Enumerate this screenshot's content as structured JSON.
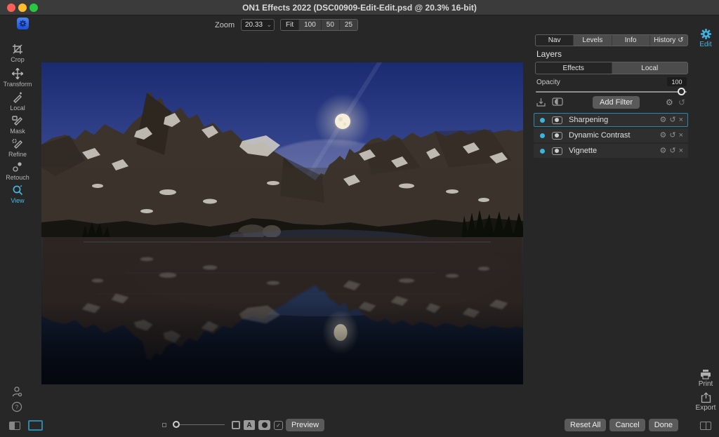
{
  "titlebar": {
    "title": "ON1 Effects 2022 (DSC00909-Edit-Edit.psd @ 20.3% 16-bit)"
  },
  "topbar": {
    "zoom_label": "Zoom",
    "zoom_value": "20.33",
    "fit_options": {
      "0": "Fit",
      "1": "100",
      "2": "50",
      "3": "25"
    },
    "active_fit": "Fit"
  },
  "left_toolbar": {
    "tools": [
      {
        "label": "Crop"
      },
      {
        "label": "Transform"
      },
      {
        "label": "Local"
      },
      {
        "label": "Mask"
      },
      {
        "label": "Refine"
      },
      {
        "label": "Retouch"
      },
      {
        "label": "View"
      }
    ],
    "active_tool": "View"
  },
  "right_rail": {
    "edit_label": "Edit",
    "print_label": "Print",
    "export_label": "Export"
  },
  "right_panel": {
    "tabs": [
      {
        "label": "Nav",
        "active": true
      },
      {
        "label": "Levels",
        "active": false
      },
      {
        "label": "Info",
        "active": false
      },
      {
        "label": "History",
        "active": false
      }
    ],
    "layers_title": "Layers",
    "layer_tabs": [
      {
        "label": "Effects",
        "active": true
      },
      {
        "label": "Local",
        "active": false
      }
    ],
    "opacity": {
      "label": "Opacity",
      "value": "100"
    },
    "add_filter_label": "Add Filter",
    "filters": [
      {
        "name": "Sharpening",
        "selected": true
      },
      {
        "name": "Dynamic Contrast",
        "selected": false
      },
      {
        "name": "Vignette",
        "selected": false
      }
    ]
  },
  "bottom_bar": {
    "preview_label": "Preview",
    "reset_all_label": "Reset All",
    "cancel_label": "Cancel",
    "done_label": "Done",
    "a_toggle": "A"
  },
  "icons": {
    "gear": "⚙",
    "undo": "↺",
    "close": "×",
    "chevron_down": "⌄",
    "check": "✓",
    "person": "⚲",
    "help": "?"
  },
  "colors": {
    "accent": "#3cb4e0",
    "selection_border": "#2e86ab",
    "chrome": "#272727",
    "titlebar": "#3b3b3b"
  }
}
